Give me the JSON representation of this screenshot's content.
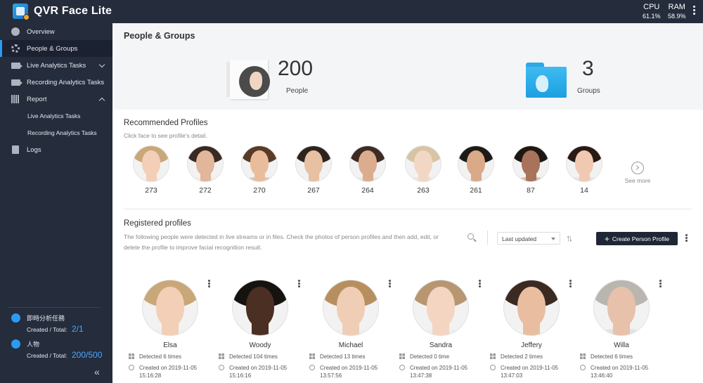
{
  "app": {
    "title": "QVR Face Lite"
  },
  "stats": {
    "cpu_label": "CPU",
    "cpu_value": "61.1%",
    "ram_label": "RAM",
    "ram_value": "58.9%"
  },
  "sidebar": {
    "items": [
      {
        "label": "Overview"
      },
      {
        "label": "People & Groups"
      },
      {
        "label": "Live Analytics Tasks"
      },
      {
        "label": "Recording Analytics Tasks"
      },
      {
        "label": "Report"
      },
      {
        "label": "Live Analytics Tasks"
      },
      {
        "label": "Recording Analytics Tasks"
      },
      {
        "label": "Logs"
      }
    ],
    "status": [
      {
        "name": "即時分析任務",
        "label": "Created / Total:",
        "value": "2/1"
      },
      {
        "name": "人物",
        "label": "Created / Total:",
        "value": "200/500"
      }
    ],
    "collapse_glyph": "«"
  },
  "main": {
    "title": "People & Groups",
    "people": {
      "count": "200",
      "label": "People"
    },
    "groups": {
      "count": "3",
      "label": "Groups"
    }
  },
  "recommended": {
    "title": "Recommended Profiles",
    "subtitle": "Click face to see profile's detail.",
    "profiles": [
      {
        "count": "273",
        "skin": "#f2cfb6",
        "hair": "#c9a779",
        "shirt": "#f0f0f0"
      },
      {
        "count": "272",
        "skin": "#e2b69a",
        "hair": "#3a2a22",
        "shirt": "#ececec"
      },
      {
        "count": "270",
        "skin": "#e9bd9c",
        "hair": "#5a3b27",
        "shirt": "#d8c8b6"
      },
      {
        "count": "267",
        "skin": "#e8c0a2",
        "hair": "#2e241e",
        "shirt": "#f3f3f3"
      },
      {
        "count": "264",
        "skin": "#dcac8e",
        "hair": "#3c2c24",
        "shirt": "#e6e6e6"
      },
      {
        "count": "263",
        "skin": "#f3d7c5",
        "hair": "#d8c4a4",
        "shirt": "#eae6e0"
      },
      {
        "count": "261",
        "skin": "#d9a988",
        "hair": "#1d1a18",
        "shirt": "#f0f0f0"
      },
      {
        "count": "87",
        "skin": "#a8735a",
        "hair": "#1f1714",
        "shirt": "#d3c0b0"
      },
      {
        "count": "14",
        "skin": "#f1c9b2",
        "hair": "#2a1a14",
        "shirt": "#e9e2dc"
      }
    ],
    "see_more": "See more"
  },
  "registered": {
    "title": "Registered profiles",
    "description": "The following people were detected in live streams or in files. Check the photos of person profiles and then add, edit, or delete the profile to improve facial recognition result.",
    "sort_selected": "Last updated",
    "sort_icon": "↑↓",
    "create_button": "Create Person Profile",
    "cards": [
      {
        "name": "Elsa",
        "detected": "Detected 6 times",
        "created_line1": "Created on 2019-11-05",
        "created_line2": "15:16:28",
        "skin": "#f2cfb6",
        "hair": "#c9a779",
        "shirt": "#f0f0f0"
      },
      {
        "name": "Woody",
        "detected": "Detected 104 times",
        "created_line1": "Created on 2019-11-05",
        "created_line2": "15:16:16",
        "skin": "#4a2f22",
        "hair": "#161210",
        "shirt": "#f4f4f4"
      },
      {
        "name": "Michael",
        "detected": "Detected 13 times",
        "created_line1": "Created on 2019-11-05",
        "created_line2": "13:57:56",
        "skin": "#f0cdb5",
        "hair": "#b78f5f",
        "shirt": "#f0f0f0"
      },
      {
        "name": "Sandra",
        "detected": "Detected 0 time",
        "created_line1": "Created on 2019-11-05",
        "created_line2": "13:47:38",
        "skin": "#f4d5c2",
        "hair": "#b79671",
        "shirt": "#efefef"
      },
      {
        "name": "Jeffery",
        "detected": "Detected 2 times",
        "created_line1": "Created on 2019-11-05",
        "created_line2": "13:47:03",
        "skin": "#e9bea0",
        "hair": "#3b2a21",
        "shirt": "#f4f4f4"
      },
      {
        "name": "Willa",
        "detected": "Detected 6 times",
        "created_line1": "Created on 2019-11-05",
        "created_line2": "13:46:40",
        "skin": "#e7c1aa",
        "hair": "#b9b6b0",
        "shirt": "#e2e2e2"
      }
    ]
  },
  "colors": {
    "topbar": "#252c3c",
    "accent": "#2b9af3",
    "status_value": "#4aa8ff",
    "button_dark": "#1f2636"
  }
}
